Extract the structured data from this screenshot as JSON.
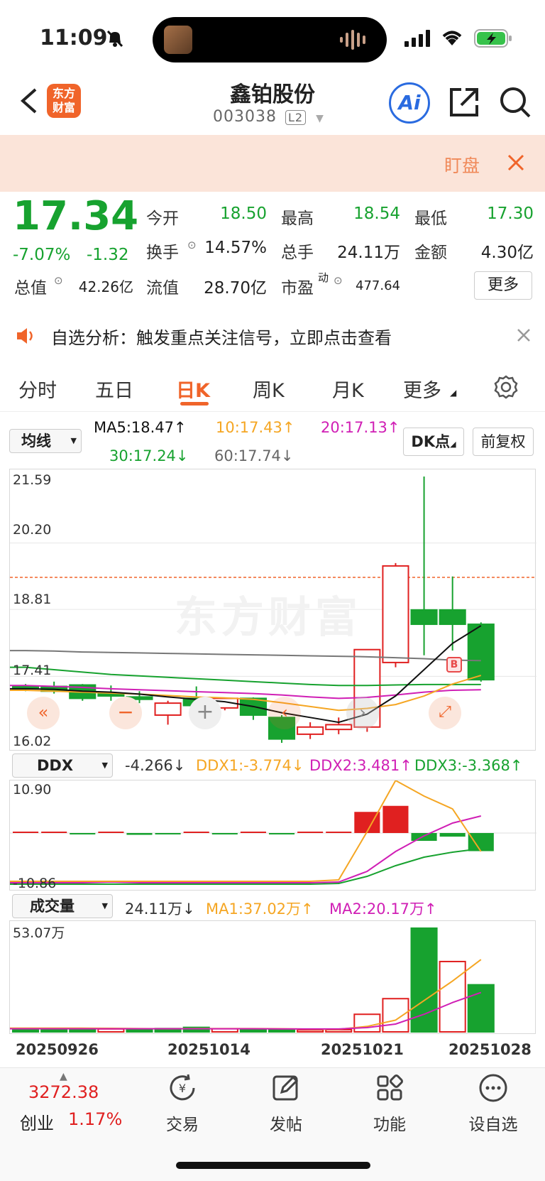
{
  "status": {
    "time": "11:09"
  },
  "header": {
    "title": "鑫铂股份",
    "code": "003038",
    "level": "L2",
    "logo_text_1": "东方",
    "logo_text_2": "财富",
    "ai_label": "Ai"
  },
  "alert": {
    "label": "盯盘"
  },
  "quote": {
    "price": "17.34",
    "change_pct": "-7.07%",
    "change": "-1.32",
    "open_label": "今开",
    "open": "18.50",
    "high_label": "最高",
    "high": "18.54",
    "low_label": "最低",
    "low": "17.30",
    "turnover_label": "换手",
    "turnover": "14.57%",
    "volume_label": "总手",
    "volume": "24.11万",
    "amount_label": "金额",
    "amount": "4.30亿",
    "mcap_label": "总值",
    "mcap": "42.26亿",
    "float_label": "流值",
    "float": "28.70亿",
    "pe_label": "市盈",
    "pe_sup": "动",
    "pe": "477.64",
    "more": "更多"
  },
  "notice": {
    "text": "自选分析：触发重点关注信号，立即点击查看"
  },
  "tabs": [
    "分时",
    "五日",
    "日K",
    "周K",
    "月K",
    "更多"
  ],
  "active_tab": 2,
  "kline": {
    "indicator": "均线",
    "ma5": "MA5:18.47↑",
    "ma10": "10:17.43↑",
    "ma20": "20:17.13↑",
    "ma30": "30:17.24↓",
    "ma60": "60:17.74↓",
    "dk_button": "DK点",
    "adjust_button": "前复权",
    "price_labels": [
      "21.59",
      "20.20",
      "18.81",
      "17.41",
      "16.02"
    ],
    "b_marker": "B",
    "watermark": "东方财富"
  },
  "ddx": {
    "indicator": "DDX",
    "value": "-4.266↓",
    "ddx1": "DDX1:-3.774↓",
    "ddx2": "DDX2:3.481↑",
    "ddx3": "DDX3:-3.368↑",
    "top": "10.90",
    "bottom": "-10.86"
  },
  "vol": {
    "indicator": "成交量",
    "value": "24.11万↓",
    "ma1": "MA1:37.02万↑",
    "ma2": "MA2:20.17万↑",
    "top": "53.07万"
  },
  "dates": [
    "20250926",
    "20251014",
    "20251021",
    "20251028"
  ],
  "bottom": {
    "index_value": "3272.38",
    "index_name": "创业",
    "index_pct": "1.17%",
    "nav": [
      "交易",
      "发帖",
      "功能",
      "设自选"
    ]
  },
  "colors": {
    "up": "#e02020",
    "down": "#17a22f",
    "accent": "#f0642a"
  },
  "chart_data": {
    "type": "candlestick",
    "dates_shown": [
      "20250926",
      "20251014",
      "20251021",
      "20251028"
    ],
    "ylim": [
      16.02,
      21.59
    ],
    "candles": [
      {
        "o": 17.2,
        "c": 17.15,
        "h": 17.25,
        "l": 17.1
      },
      {
        "o": 17.2,
        "c": 17.1,
        "h": 17.3,
        "l": 17.05
      },
      {
        "o": 17.23,
        "c": 16.95,
        "h": 17.25,
        "l": 16.9
      },
      {
        "o": 17.05,
        "c": 17.0,
        "h": 17.22,
        "l": 16.9
      },
      {
        "o": 16.98,
        "c": 16.93,
        "h": 17.1,
        "l": 16.85
      },
      {
        "o": 16.6,
        "c": 16.85,
        "h": 16.9,
        "l": 16.4
      },
      {
        "o": 16.95,
        "c": 16.8,
        "h": 17.2,
        "l": 16.75
      },
      {
        "o": 16.75,
        "c": 16.95,
        "h": 16.97,
        "l": 16.7
      },
      {
        "o": 16.95,
        "c": 16.6,
        "h": 16.97,
        "l": 16.5
      },
      {
        "o": 16.55,
        "c": 16.1,
        "h": 16.6,
        "l": 16.02
      },
      {
        "o": 16.2,
        "c": 16.35,
        "h": 16.45,
        "l": 16.1
      },
      {
        "o": 16.3,
        "c": 16.4,
        "h": 16.55,
        "l": 16.2
      },
      {
        "o": 16.35,
        "c": 17.97,
        "h": 17.97,
        "l": 16.25
      },
      {
        "o": 17.7,
        "c": 19.72,
        "h": 19.78,
        "l": 17.6
      },
      {
        "o": 18.8,
        "c": 18.5,
        "h": 21.59,
        "l": 17.85
      },
      {
        "o": 18.8,
        "c": 18.5,
        "h": 19.5,
        "l": 17.95
      },
      {
        "o": 18.5,
        "c": 17.34,
        "h": 18.54,
        "l": 17.3
      }
    ],
    "ma5": [
      17.15,
      17.14,
      17.1,
      17.08,
      17.04,
      16.98,
      16.93,
      16.88,
      16.78,
      16.65,
      16.55,
      16.45,
      16.62,
      17.0,
      17.55,
      18.1,
      18.47
    ],
    "ma10": [
      17.12,
      17.1,
      17.08,
      17.06,
      17.04,
      17.01,
      16.98,
      16.96,
      16.93,
      16.86,
      16.78,
      16.7,
      16.74,
      16.82,
      17.0,
      17.25,
      17.43
    ],
    "ma20": [
      17.22,
      17.2,
      17.18,
      17.15,
      17.13,
      17.11,
      17.09,
      17.07,
      17.05,
      17.02,
      16.98,
      16.95,
      16.97,
      17.02,
      17.08,
      17.12,
      17.13
    ],
    "ma30": [
      17.6,
      17.55,
      17.5,
      17.45,
      17.42,
      17.39,
      17.36,
      17.33,
      17.3,
      17.27,
      17.24,
      17.22,
      17.22,
      17.23,
      17.24,
      17.24,
      17.24
    ],
    "ma60": [
      17.95,
      17.94,
      17.92,
      17.91,
      17.9,
      17.89,
      17.88,
      17.87,
      17.86,
      17.85,
      17.84,
      17.83,
      17.82,
      17.8,
      17.78,
      17.75,
      17.74
    ],
    "ddx": [
      0,
      0,
      -0.2,
      0,
      -0.3,
      -0.1,
      0,
      -0.1,
      0,
      -0.1,
      0,
      0,
      3.5,
      4.5,
      -1.3,
      -0.6,
      -3.0
    ],
    "volume_wan": [
      1.8,
      1.7,
      1.6,
      1.5,
      1.6,
      1.7,
      2.3,
      1.6,
      1.5,
      1.3,
      1.0,
      1.1,
      9.0,
      17.0,
      53.07,
      36.0,
      24.11
    ],
    "volume_up": [
      false,
      false,
      false,
      true,
      false,
      false,
      false,
      true,
      false,
      false,
      true,
      true,
      true,
      true,
      false,
      true,
      false
    ],
    "vol_ma1": [
      1.9,
      1.9,
      1.9,
      1.8,
      1.7,
      1.6,
      1.7,
      1.7,
      1.7,
      1.6,
      1.4,
      1.3,
      2.8,
      6.0,
      16.0,
      26.0,
      37.02
    ],
    "vol_ma2": [
      1.6,
      1.6,
      1.6,
      1.6,
      1.6,
      1.6,
      1.6,
      1.6,
      1.6,
      1.5,
      1.5,
      1.5,
      2.2,
      4.0,
      9.0,
      15.0,
      20.17
    ]
  }
}
